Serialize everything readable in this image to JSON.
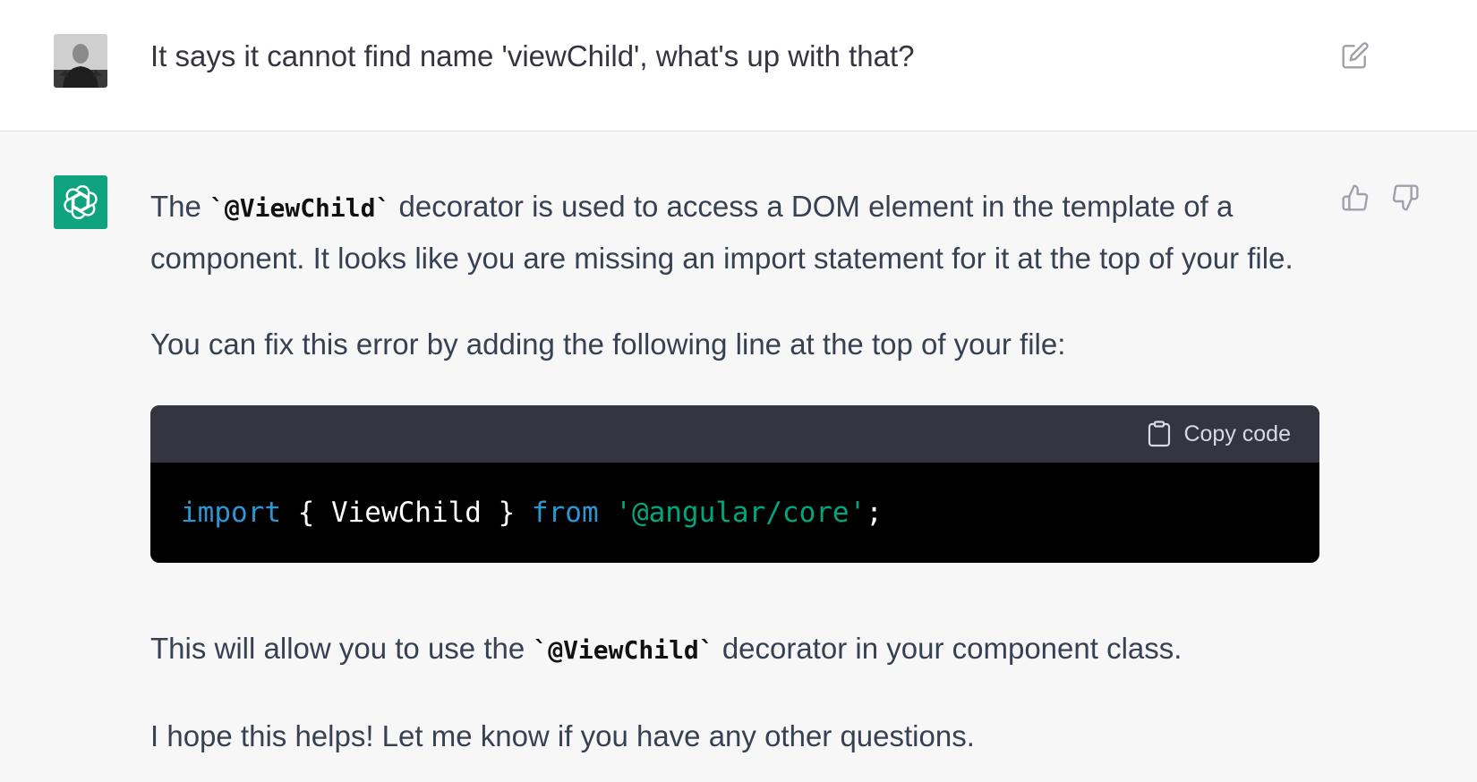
{
  "user_message": {
    "text": "It says it cannot find name 'viewChild', what's up with that?"
  },
  "assistant_message": {
    "p1_before": "The ",
    "p1_code": "`@ViewChild`",
    "p1_after": " decorator is used to access a DOM element in the template of a component. It looks like you are missing an import statement for it at the top of your file.",
    "p2": "You can fix this error by adding the following line at the top of your file:",
    "code_block": {
      "copy_label": "Copy code",
      "tokens": {
        "kw_import": "import",
        "braces": " { ViewChild } ",
        "kw_from": "from",
        "space": " ",
        "string": "'@angular/core'",
        "semicolon": ";"
      }
    },
    "p3_before": "This will allow you to use the ",
    "p3_code": "`@ViewChild`",
    "p3_after": " decorator in your component class.",
    "p4": "I hope this helps! Let me know if you have any other questions."
  },
  "icons": {
    "edit": "edit-icon",
    "thumbs_up": "thumbs-up-icon",
    "thumbs_down": "thumbs-down-icon",
    "clipboard": "clipboard-icon",
    "assistant_logo": "openai-logo-icon"
  },
  "colors": {
    "assistant_avatar_bg": "#10a37f",
    "code_keyword": "#2e95d3",
    "code_string": "#00a67d",
    "code_header_bg": "#343541"
  }
}
